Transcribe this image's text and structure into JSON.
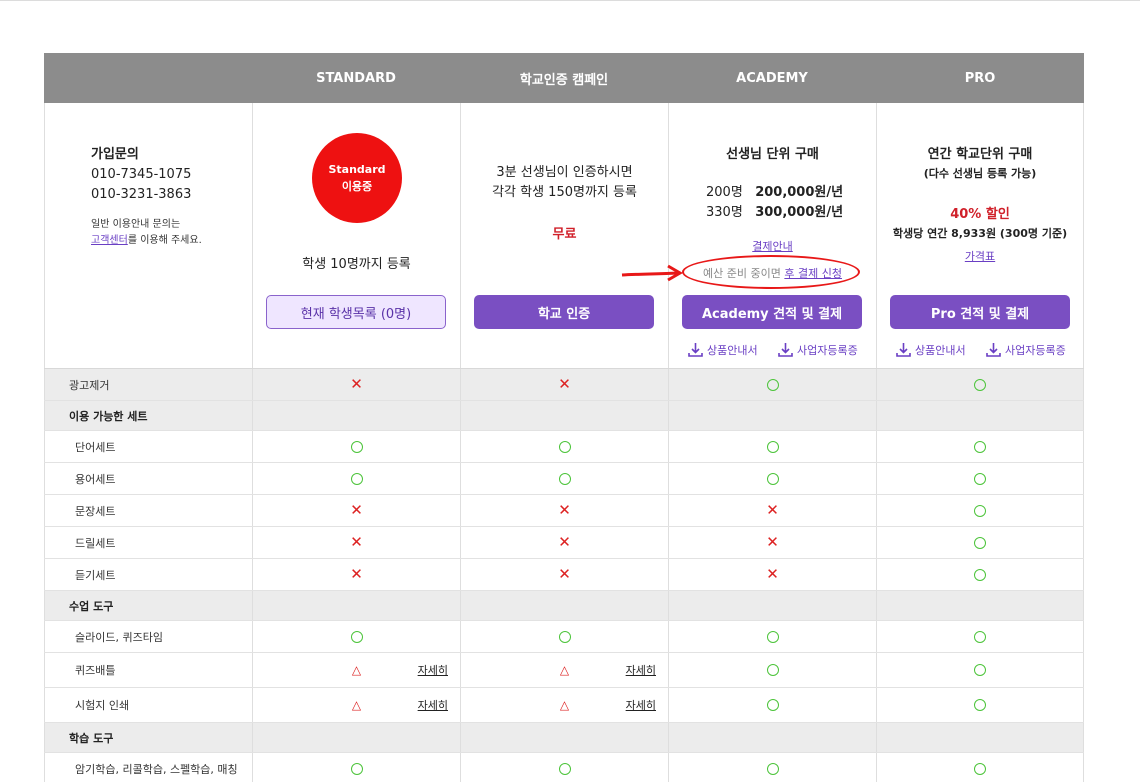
{
  "header": [
    "STANDARD",
    "학교인증 캠페인",
    "ACADEMY",
    "PRO"
  ],
  "contact": {
    "title": "가입문의",
    "phone1": "010-7345-1075",
    "phone2": "010-3231-3863",
    "note_prefix": "일반 이용안내 문의는",
    "note_link": "고객센터",
    "note_suffix": "를 이용해 주세요."
  },
  "standard": {
    "badge_line1": "Standard",
    "badge_line2": "이용중",
    "desc": "학생 10명까지 등록",
    "button": "현재 학생목록 (0명)"
  },
  "campaign": {
    "desc_line1": "3분 선생님이 인증하시면",
    "desc_line2": "각각 학생 150명까지 등록",
    "price": "무료",
    "button": "학교 인증"
  },
  "academy": {
    "title": "선생님 단위 구매",
    "plan1_count": "200명",
    "plan1_price": "200,000원/년",
    "plan2_count": "330명",
    "plan2_price": "300,000원/년",
    "payment_link": "결제안내",
    "budget_text": "예산 준비 중이면",
    "budget_link": "후 결제 신청",
    "button": "Academy 견적 및 결제",
    "dl1": "상품안내서",
    "dl2": "사업자등록증"
  },
  "pro": {
    "title": "연간 학교단위 구매",
    "subtitle": "(다수 선생님 등록 가능)",
    "discount": "40% 할인",
    "price_note": "학생당 연간 8,933원 (300명 기준)",
    "price_link": "가격표",
    "button": "Pro 견적 및 결제",
    "dl1": "상품안내서",
    "dl2": "사업자등록증"
  },
  "rows": [
    {
      "label": "광고제거",
      "type": "gray",
      "marks": [
        "x",
        "x",
        "o",
        "o"
      ]
    },
    {
      "label": "이용 가능한 세트",
      "type": "section",
      "marks": [
        "",
        "",
        "",
        ""
      ]
    },
    {
      "label": "단어세트",
      "type": "row",
      "marks": [
        "o",
        "o",
        "o",
        "o"
      ]
    },
    {
      "label": "용어세트",
      "type": "row",
      "marks": [
        "o",
        "o",
        "o",
        "o"
      ]
    },
    {
      "label": "문장세트",
      "type": "row",
      "marks": [
        "x",
        "x",
        "x",
        "o"
      ]
    },
    {
      "label": "드릴세트",
      "type": "row",
      "marks": [
        "x",
        "x",
        "x",
        "o"
      ]
    },
    {
      "label": "듣기세트",
      "type": "row",
      "marks": [
        "x",
        "x",
        "x",
        "o"
      ]
    },
    {
      "label": "수업 도구",
      "type": "section",
      "marks": [
        "",
        "",
        "",
        ""
      ]
    },
    {
      "label": "슬라이드, 퀴즈타임",
      "type": "row",
      "marks": [
        "o",
        "o",
        "o",
        "o"
      ]
    },
    {
      "label": "퀴즈배틀",
      "type": "row",
      "marks": [
        "t",
        "t",
        "o",
        "o"
      ],
      "detail": "자세히"
    },
    {
      "label": "시험지 인쇄",
      "type": "row",
      "marks": [
        "t",
        "t",
        "o",
        "o"
      ],
      "detail": "자세히"
    },
    {
      "label": "학습 도구",
      "type": "section",
      "marks": [
        "",
        "",
        "",
        ""
      ]
    },
    {
      "label": "암기학습, 리콜학습, 스펠학습, 매칭",
      "type": "row",
      "marks": [
        "o",
        "o",
        "o",
        "o"
      ]
    }
  ],
  "symbols": {
    "x": "✕",
    "t": "△"
  }
}
